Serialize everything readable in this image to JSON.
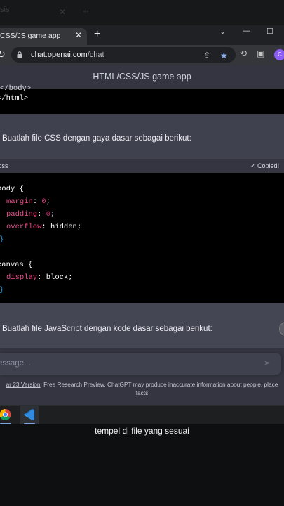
{
  "background_tab": {
    "label": "sis",
    "close": "✕",
    "new": "+"
  },
  "browser": {
    "tab_title": "CSS/JS game app",
    "tab_close": "✕",
    "new_tab": "+",
    "window_controls": {
      "minimize": "⌄",
      "restore": "—",
      "maximize": "☐"
    },
    "url_domain": "chat.openai.com",
    "url_path": "/chat",
    "avatar_initial": "C"
  },
  "app": {
    "title": "HTML/CSS/JS game app"
  },
  "conversation": {
    "prev_code_tail": [
      "</body>",
      "</html>"
    ],
    "user_message": "Buatlah file CSS dengan gaya dasar sebagai berikut:",
    "code_block": {
      "lang": "css",
      "copy_label": "Copied!",
      "lines": [
        {
          "sel": "body {"
        },
        {
          "prop": "margin",
          "val": "0"
        },
        {
          "prop": "padding",
          "val": "0"
        },
        {
          "prop": "overflow",
          "val": "hidden",
          "plain": true
        },
        {
          "close": "}"
        },
        {
          "sel": "canvas {"
        },
        {
          "prop": "display",
          "val": "block",
          "plain": true
        },
        {
          "close": "}"
        }
      ]
    },
    "assistant_message": "Buatlah file JavaScript dengan kode dasar sebagai berikut:"
  },
  "composer": {
    "placeholder": "essage..."
  },
  "footer": {
    "version_link": "ar 23 Version",
    "text": ". Free Research Preview. ChatGPT may produce inaccurate information about people, place",
    "text2": "facts"
  },
  "caption": "tempel di file yang sesuai",
  "colors": {
    "accent": "#8ab4f8",
    "code_prop": "#ef4a8a",
    "code_num": "#df3079"
  }
}
